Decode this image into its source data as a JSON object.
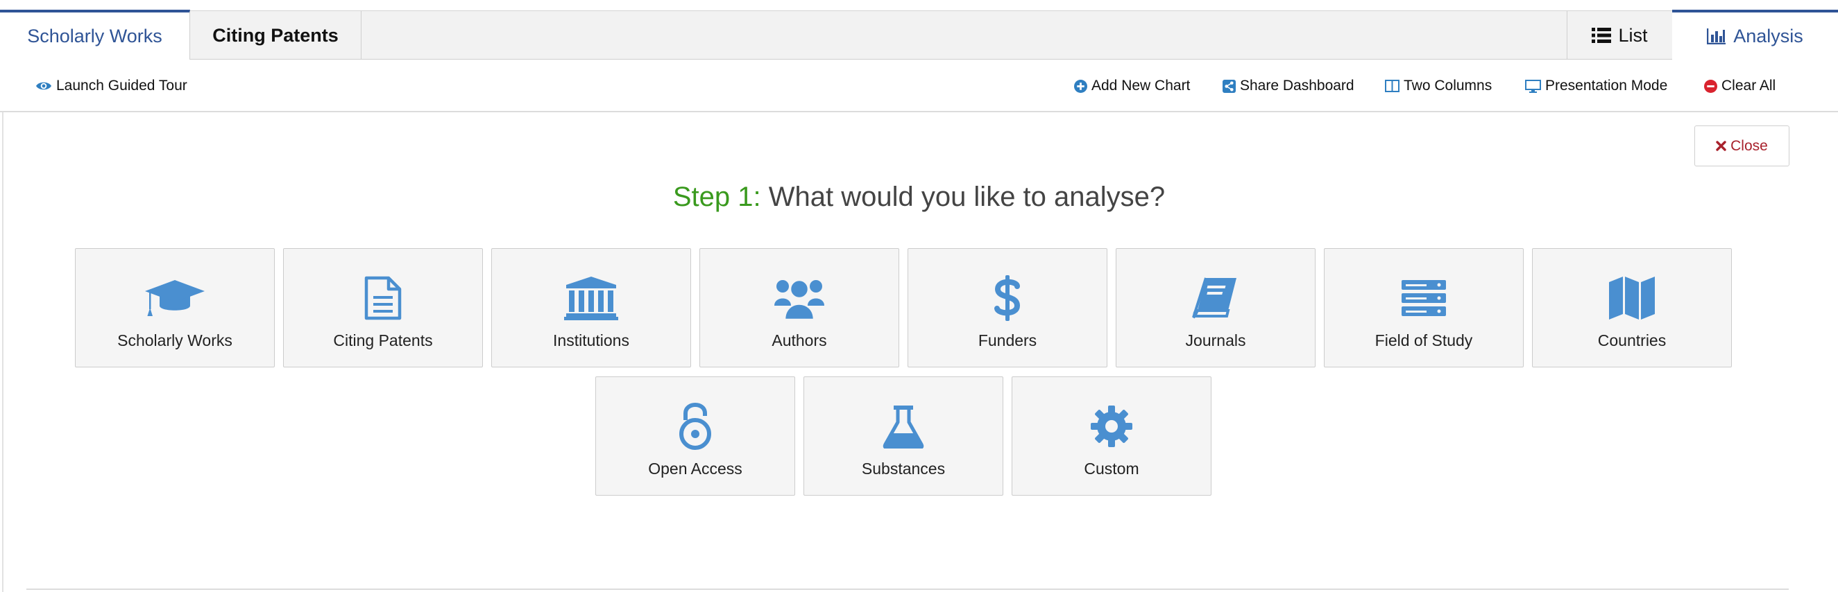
{
  "tabs": {
    "scholarly_works": "Scholarly Works",
    "citing_patents": "Citing Patents",
    "list": "List",
    "analysis": "Analysis"
  },
  "toolbar": {
    "launch_tour": "Launch Guided Tour",
    "add_chart": "Add New Chart",
    "share_dashboard": "Share Dashboard",
    "two_columns": "Two Columns",
    "presentation_mode": "Presentation Mode",
    "clear_all": "Clear All"
  },
  "close_label": "Close",
  "step": {
    "lead": "Step 1:",
    "question": "What would you like to analyse?"
  },
  "options": [
    {
      "label": "Scholarly Works",
      "icon": "graduation-cap-icon"
    },
    {
      "label": "Citing Patents",
      "icon": "document-icon"
    },
    {
      "label": "Institutions",
      "icon": "institution-icon"
    },
    {
      "label": "Authors",
      "icon": "users-icon"
    },
    {
      "label": "Funders",
      "icon": "dollar-icon"
    },
    {
      "label": "Journals",
      "icon": "book-icon"
    },
    {
      "label": "Field of Study",
      "icon": "server-icon"
    },
    {
      "label": "Countries",
      "icon": "map-icon"
    },
    {
      "label": "Open Access",
      "icon": "open-lock-icon"
    },
    {
      "label": "Substances",
      "icon": "flask-icon"
    },
    {
      "label": "Custom",
      "icon": "gear-icon"
    }
  ],
  "colors": {
    "brand_blue": "#2f5496",
    "icon_blue": "#4a8fd0",
    "step_green": "#3a9a1e",
    "close_red": "#a8212c",
    "clear_red": "#d9232e"
  }
}
